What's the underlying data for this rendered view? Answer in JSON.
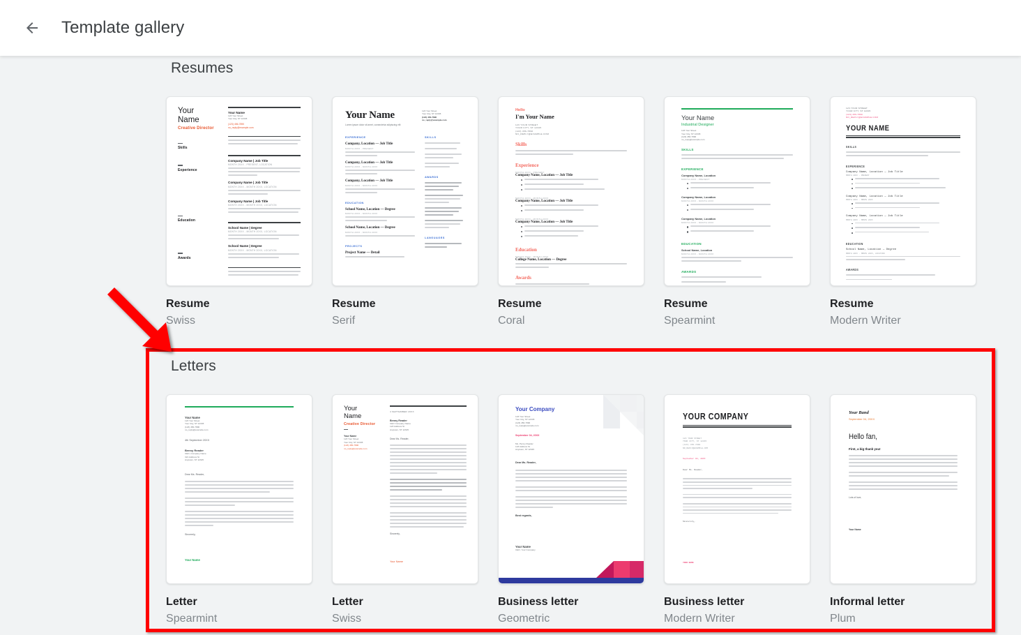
{
  "header": {
    "title": "Template gallery",
    "back_icon": "arrow-left-icon"
  },
  "sections": [
    {
      "id": "resumes",
      "title": "Resumes",
      "templates": [
        {
          "name": "Resume",
          "variant": "Swiss",
          "preview": "swiss-resume"
        },
        {
          "name": "Resume",
          "variant": "Serif",
          "preview": "serif-resume"
        },
        {
          "name": "Resume",
          "variant": "Coral",
          "preview": "coral-resume"
        },
        {
          "name": "Resume",
          "variant": "Spearmint",
          "preview": "spearmint-resume"
        },
        {
          "name": "Resume",
          "variant": "Modern Writer",
          "preview": "modern-writer-resume"
        }
      ]
    },
    {
      "id": "letters",
      "title": "Letters",
      "highlighted": true,
      "templates": [
        {
          "name": "Letter",
          "variant": "Spearmint",
          "preview": "spearmint-letter"
        },
        {
          "name": "Letter",
          "variant": "Swiss",
          "preview": "swiss-letter"
        },
        {
          "name": "Business letter",
          "variant": "Geometric",
          "preview": "geometric-letter"
        },
        {
          "name": "Business letter",
          "variant": "Modern Writer",
          "preview": "modern-writer-letter"
        },
        {
          "name": "Informal letter",
          "variant": "Plum",
          "preview": "plum-letter"
        }
      ]
    }
  ],
  "previews": {
    "swiss_resume": {
      "name_line1": "Your",
      "name_line2": "Name",
      "role": "Creative Director",
      "contact_name": "Your Name",
      "contact_street": "123 Your Street",
      "contact_city": "Your City, ST 12345",
      "contact_phone": "(123) 456-7890",
      "contact_email": "no_reply@example.com",
      "sections": [
        "Skills",
        "Experience",
        "Education",
        "Awards"
      ],
      "entry_heading": "Company Name | Job Title",
      "entry_sub_present": "MONTH 20XX - PRESENT, LOCATION",
      "entry_sub_range": "MONTH 20XX - MONTH 20XX, LOCATION",
      "school_heading": "School Name | Degree"
    },
    "serif_resume": {
      "name": "Your Name",
      "tagline": "Lorem ipsum dolor sit amet, consectetur adipiscing elit",
      "contact": [
        "123 Your Street",
        "Your City, ST 12345",
        "(123) 456-7890",
        "no_reply@example.com"
      ],
      "left_sections": [
        "EXPERIENCE",
        "EDUCATION",
        "PROJECTS"
      ],
      "right_sections": [
        "SKILLS",
        "AWARDS",
        "LANGUAGES"
      ],
      "entry_heading": "Company, Location — Job Title",
      "school_heading": "School Name, Location — Degree",
      "project_heading": "Project Name — Detail"
    },
    "coral_resume": {
      "hello": "Hello",
      "name": "I'm Your Name",
      "contact": [
        "123 YOUR STREET",
        "YOUR CITY, ST 12345",
        "(123) 456-7890",
        "NO_REPLY@EXAMPLE.COM"
      ],
      "sections": [
        "Skills",
        "Experience",
        "Education",
        "Awards"
      ],
      "entry_heading": "Company Name, Location — Job Title",
      "entry_sub_present": "MONTH 20XX - PRESENT",
      "entry_sub_range": "MONTH 20XX - MONTH 20XX",
      "college_heading": "College Name, Location — Degree"
    },
    "spearmint_resume": {
      "name": "Your Name",
      "role": "Industrial Designer",
      "contact": [
        "123 Your Street",
        "Your City, ST 12345",
        "(123) 456-7890",
        "no_reply@example.com"
      ],
      "sections": [
        "SKILLS",
        "EXPERIENCE",
        "EDUCATION",
        "AWARDS"
      ],
      "entry_heading": "Company Name, Location",
      "entry_job": " - Job Title",
      "entry_sub": "MONTH 20XX - PRESENT",
      "school_heading": "School Name, Location",
      "school_degree": " - Degree"
    },
    "modern_writer_resume": {
      "contact": [
        "123 YOUR STREET",
        "YOUR CITY, ST 12345",
        "(123) 456-7890",
        "NO_REPLY@EXAMPLE.COM"
      ],
      "name": "YOUR NAME",
      "sections": [
        "SKILLS",
        "EXPERIENCE",
        "EDUCATION",
        "AWARDS"
      ],
      "entry_heading": "Company Name, Location",
      "entry_job": " — Job Title",
      "entry_sub": "MONTH 20XX - PRESENT",
      "school_heading": "School Name, Location",
      "school_degree": " — Degree"
    },
    "spearmint_letter": {
      "sender_name": "Your Name",
      "sender_lines": [
        "123 Your Street",
        "Your City, ST 12345",
        "(123) 456-7890",
        "no_reply@example.com"
      ],
      "date": "4th September 20XX",
      "recipient_name": "Benny Reader",
      "recipient_lines": [
        "CEO, Company Name",
        "321 Address St",
        "Anytown, ST 12345"
      ],
      "salutation": "Dear Ms. Reader,",
      "closing": "Sincerely,",
      "signature": "Your Name"
    },
    "swiss_letter": {
      "name_line1": "Your",
      "name_line2": "Name",
      "role": "Creative Director",
      "sender_name": "Your Name",
      "sender_lines": [
        "123 Your Street",
        "Your City, ST 12345",
        "(123) 456-7890",
        "no_reply@example.com"
      ],
      "date": "4 SEPTEMBER 20XX",
      "recipient_name": "Benny Reader",
      "recipient_lines": [
        "CEO Company Name",
        "123 Address St",
        "Anytown, ST 12345"
      ],
      "salutation": "Dear Ms. Reader,",
      "closing": "Sincerely,",
      "signature": "Your Name"
    },
    "geometric_letter": {
      "company": "Your Company",
      "contact": [
        "123 Your Street",
        "Your City, ST 12345",
        "(123) 456-7890",
        "no_reply@example.com"
      ],
      "date": "September 04, 20XX",
      "recipient_lines": [
        "Ms. Penny Reader",
        "123 Address St",
        "Anytown, ST 12345"
      ],
      "salutation": "Dear Ms. Reader,",
      "closing": "Best regards,",
      "signature": "Your Name",
      "signature_title": "CEO, Your Company"
    },
    "modern_writer_letter": {
      "company": "YOUR COMPANY",
      "contact": [
        "123 YOUR STREET",
        "YOUR CITY, ST 12345",
        "(123) 456-7890",
        "NO_REPLY@EXAMPLE.COM"
      ],
      "date": "September 04, 20XX",
      "salutation": "Dear Ms. Reader,",
      "closing": "Sincerely,",
      "signature": "YOUR NAME"
    },
    "plum_letter": {
      "band": "Your Band",
      "date": "September 04, 20XX",
      "greeting": "Hello fan,",
      "lead": "First, a big thank you!",
      "closing": "Lots of love,",
      "signature": "Your Name"
    }
  },
  "annotations": {
    "highlight_color": "#ff0000",
    "arrow_color": "#ff0000",
    "arrow_points_to": "letters-section"
  }
}
